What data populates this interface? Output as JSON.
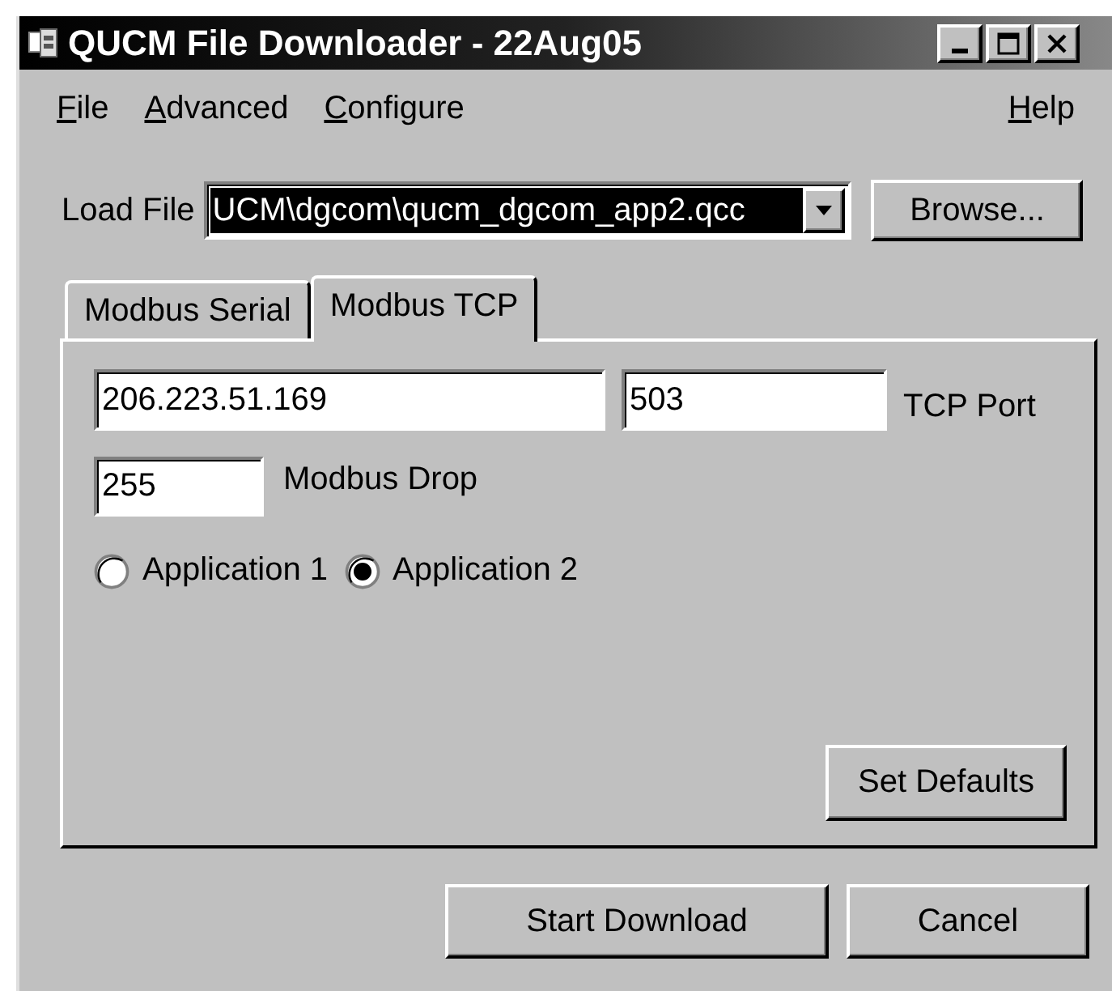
{
  "window": {
    "title": "QUCM File Downloader - 22Aug05"
  },
  "menu": {
    "left": [
      {
        "label": "File"
      },
      {
        "label": "Advanced"
      },
      {
        "label": "Configure"
      }
    ],
    "right": [
      {
        "label": "Help"
      }
    ]
  },
  "load_file": {
    "label": "Load File",
    "value": "UCM\\dgcom\\qucm_dgcom_app2.qcc",
    "highlighted": true,
    "browse": "Browse..."
  },
  "tabs": [
    {
      "label": "Modbus Serial",
      "selected": false
    },
    {
      "label": "Modbus TCP",
      "selected": true
    }
  ],
  "tcp": {
    "address": "206.223.51.169",
    "port": "503",
    "port_label": "TCP Port",
    "drop": "255",
    "drop_label": "Modbus Drop",
    "applications": [
      {
        "label": "Application 1",
        "selected": false
      },
      {
        "label": "Application 2",
        "selected": true
      }
    ],
    "set_defaults": "Set Defaults"
  },
  "buttons": [
    "Start Download",
    "Cancel"
  ]
}
